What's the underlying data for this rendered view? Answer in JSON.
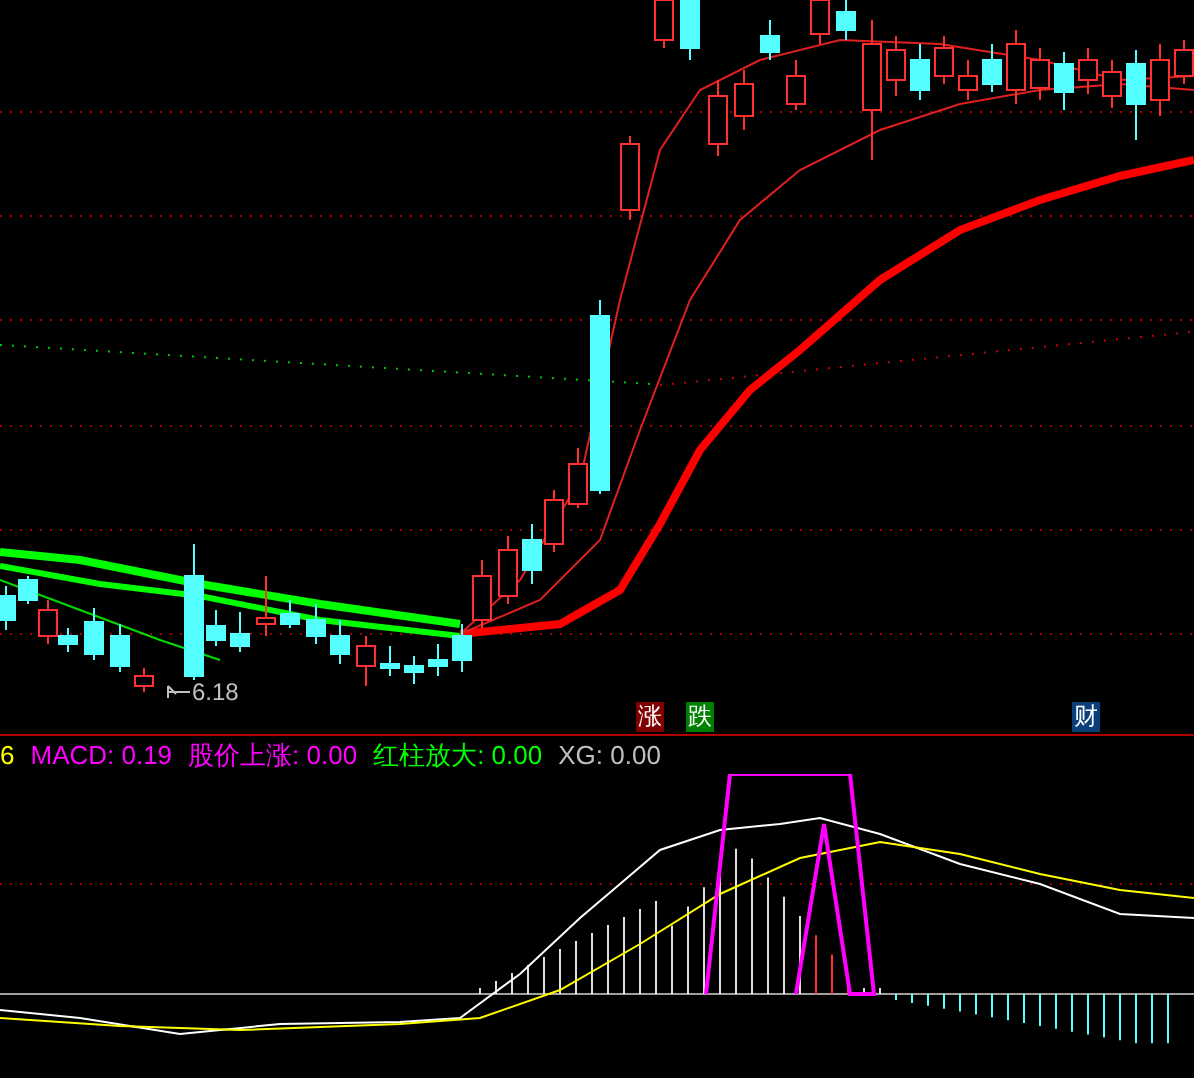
{
  "price_panel": {
    "low_label": "6.18",
    "event_markers": [
      {
        "text": "涨",
        "color": "#800000"
      },
      {
        "text": "跌",
        "color": "#008000"
      },
      {
        "text": "财",
        "color": "#0a3f7a"
      }
    ]
  },
  "indicator_header": [
    {
      "text": "6",
      "color": "#ffff00"
    },
    {
      "text": "MACD: 0.19",
      "color": "#ff00ff"
    },
    {
      "text": "股价上涨: 0.00",
      "color": "#ff00ff"
    },
    {
      "text": "红柱放大: 0.00",
      "color": "#00ff00"
    },
    {
      "text": "XG: 0.00",
      "color": "#c0c0c0"
    }
  ]
}
